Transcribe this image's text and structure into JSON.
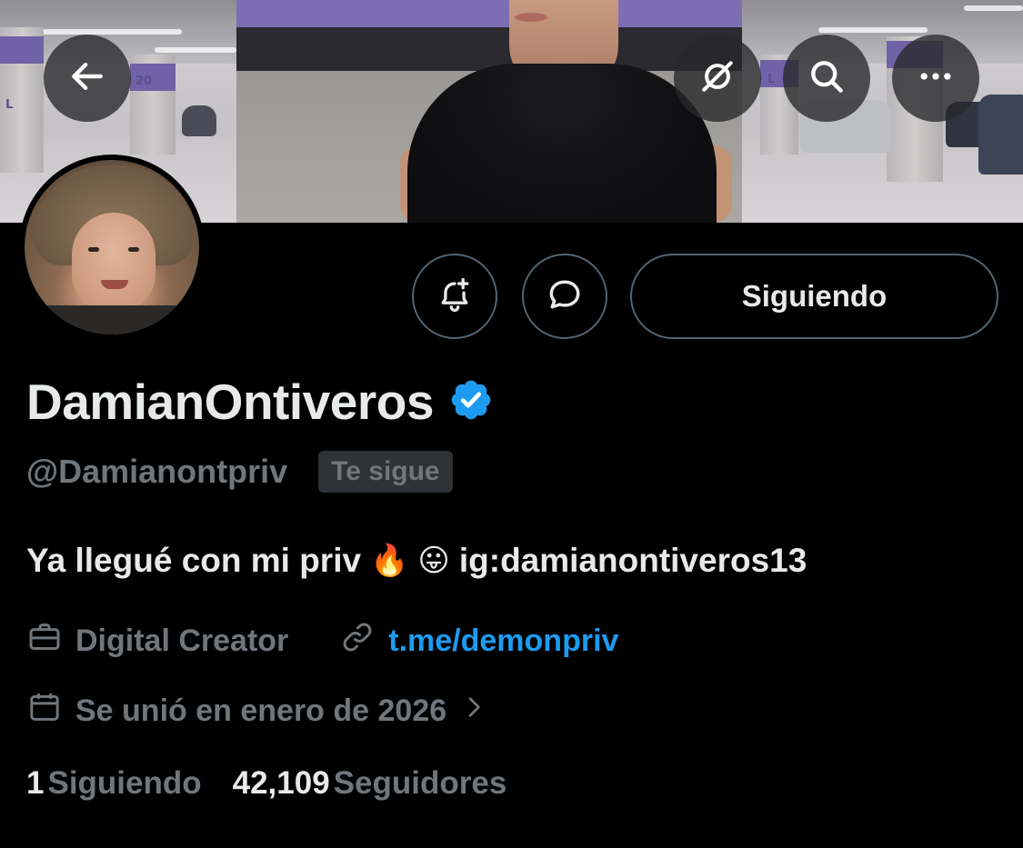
{
  "header": {
    "back_icon": "arrow-left-icon",
    "grok_icon": "grok-icon",
    "search_icon": "search-icon",
    "more_icon": "more-icon",
    "pillar_numbers": [
      "L",
      "20",
      "L"
    ]
  },
  "actions": {
    "notify_icon": "bell-plus-icon",
    "message_icon": "message-icon",
    "following_label": "Siguiendo"
  },
  "profile": {
    "display_name": "DamianOntiveros",
    "verified_icon": "verified-badge-icon",
    "handle": "@Damianontpriv",
    "follows_you": "Te sigue",
    "bio_text": "Ya llegué con mi priv",
    "bio_emoji_1": "🔥",
    "bio_emoji_2": "😛",
    "bio_ig": "ig:damianontiveros13",
    "category": "Digital Creator",
    "link": "t.me/demonpriv",
    "joined": "Se unió en enero de 2026"
  },
  "stats": {
    "following_count": "1",
    "following_label": "Siguiendo",
    "followers_count": "42,109",
    "followers_label": "Seguidores"
  },
  "colors": {
    "background": "#000000",
    "text_primary": "#e7e9ea",
    "text_secondary": "#71767b",
    "link": "#1d9bf0",
    "verified": "#1d9bf0",
    "border": "#536471"
  }
}
